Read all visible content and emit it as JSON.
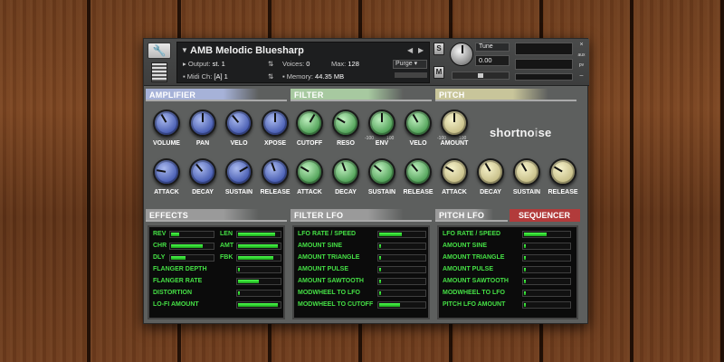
{
  "header": {
    "instrument_name": "AMB Melodic Bluesharp",
    "output_label": "Output:",
    "output_value": "st. 1",
    "voices_label": "Voices:",
    "voices_value": "0",
    "max_label": "Max:",
    "max_value": "128",
    "purge_label": "Purge",
    "midi_label": "Midi Ch:",
    "midi_value": "[A] 1",
    "memory_label": "Memory:",
    "memory_value": "44.35 MB",
    "s_label": "S",
    "m_label": "M",
    "tune_label": "Tune",
    "tune_value": "0.00",
    "close": "×",
    "aux": "aux",
    "pv": "pv",
    "minimize": "–",
    "settings": "?"
  },
  "amplifier": {
    "title": "AMPLIFIER",
    "knobs": [
      {
        "label": "VOLUME",
        "rotation": -30
      },
      {
        "label": "PAN",
        "rotation": 0
      },
      {
        "label": "VELO",
        "rotation": -40
      },
      {
        "label": "XPOSE",
        "rotation": 0
      },
      {
        "label": "ATTACK",
        "rotation": -80
      },
      {
        "label": "DECAY",
        "rotation": -40
      },
      {
        "label": "SUSTAIN",
        "rotation": 60
      },
      {
        "label": "RELEASE",
        "rotation": -20
      }
    ]
  },
  "filter": {
    "title": "FILTER",
    "knobs": [
      {
        "label": "CUTOFF",
        "rotation": 30
      },
      {
        "label": "RESO",
        "rotation": -60
      },
      {
        "label": "ENV",
        "rotation": 0
      },
      {
        "label": "VELO",
        "rotation": -30
      },
      {
        "label": "ATTACK",
        "rotation": -60
      },
      {
        "label": "DECAY",
        "rotation": -20
      },
      {
        "label": "SUSTAIN",
        "rotation": -50
      },
      {
        "label": "RELEASE",
        "rotation": -40
      }
    ],
    "env_min": "-100",
    "env_max": "100"
  },
  "pitch": {
    "title": "PITCH",
    "knobs": [
      {
        "label": "AMOUNT",
        "rotation": 0
      },
      {
        "label": "ATTACK",
        "rotation": -60
      },
      {
        "label": "DECAY",
        "rotation": -30
      },
      {
        "label": "SUSTAIN",
        "rotation": -30
      },
      {
        "label": "RELEASE",
        "rotation": -60
      }
    ],
    "amt_min": "-100",
    "amt_max": "100"
  },
  "logo": {
    "text_a": "shortno",
    "text_i": "i",
    "text_b": "se"
  },
  "effects": {
    "title": "EFFECTS",
    "pairs": [
      {
        "left": "REV",
        "left_level": 0.2,
        "right": "LEN",
        "right_level": 0.9
      },
      {
        "left": "CHR",
        "left_level": 0.75,
        "right": "AMT",
        "right_level": 0.95
      },
      {
        "left": "DLY",
        "left_level": 0.35,
        "right": "FBK",
        "right_level": 0.85
      }
    ],
    "rows": [
      {
        "label": "FLANGER DEPTH",
        "level": 0.05
      },
      {
        "label": "FLANGER RATE",
        "level": 0.5
      },
      {
        "label": "DISTORTION",
        "level": 0.05
      },
      {
        "label": "LO-FI AMOUNT",
        "level": 0.95
      }
    ]
  },
  "filter_lfo": {
    "title": "FILTER LFO",
    "rows": [
      {
        "label": "LFO RATE / SPEED",
        "level": 0.5
      },
      {
        "label": "AMOUNT SINE",
        "level": 0.0
      },
      {
        "label": "AMOUNT TRIANGLE",
        "level": 0.0
      },
      {
        "label": "AMOUNT PULSE",
        "level": 0.0
      },
      {
        "label": "AMOUNT SAWTOOTH",
        "level": 0.0
      },
      {
        "label": "MODWHEEL TO LFO",
        "level": 0.0
      },
      {
        "label": "MODWHEEL TO CUTOFF",
        "level": 0.45
      }
    ]
  },
  "pitch_lfo": {
    "title": "PITCH LFO",
    "tab": "SEQUENCER",
    "rows": [
      {
        "label": "LFO RATE / SPEED",
        "level": 0.5
      },
      {
        "label": "AMOUNT SINE",
        "level": 0.0
      },
      {
        "label": "AMOUNT TRIANGLE",
        "level": 0.0
      },
      {
        "label": "AMOUNT PULSE",
        "level": 0.0
      },
      {
        "label": "AMOUNT SAWTOOTH",
        "level": 0.0
      },
      {
        "label": "MODWHEEL TO LFO",
        "level": 0.0
      },
      {
        "label": "PITCH LFO AMOUNT",
        "level": 0.0
      }
    ]
  },
  "colors": {
    "amp_header": "#a6b2d8",
    "filter_header": "#a7c9a0",
    "pitch_header": "#c8c59a",
    "lfo_header": "#9a9a9a",
    "sequencer_tab": "#b23b3b",
    "panel_text": "#45e045"
  }
}
